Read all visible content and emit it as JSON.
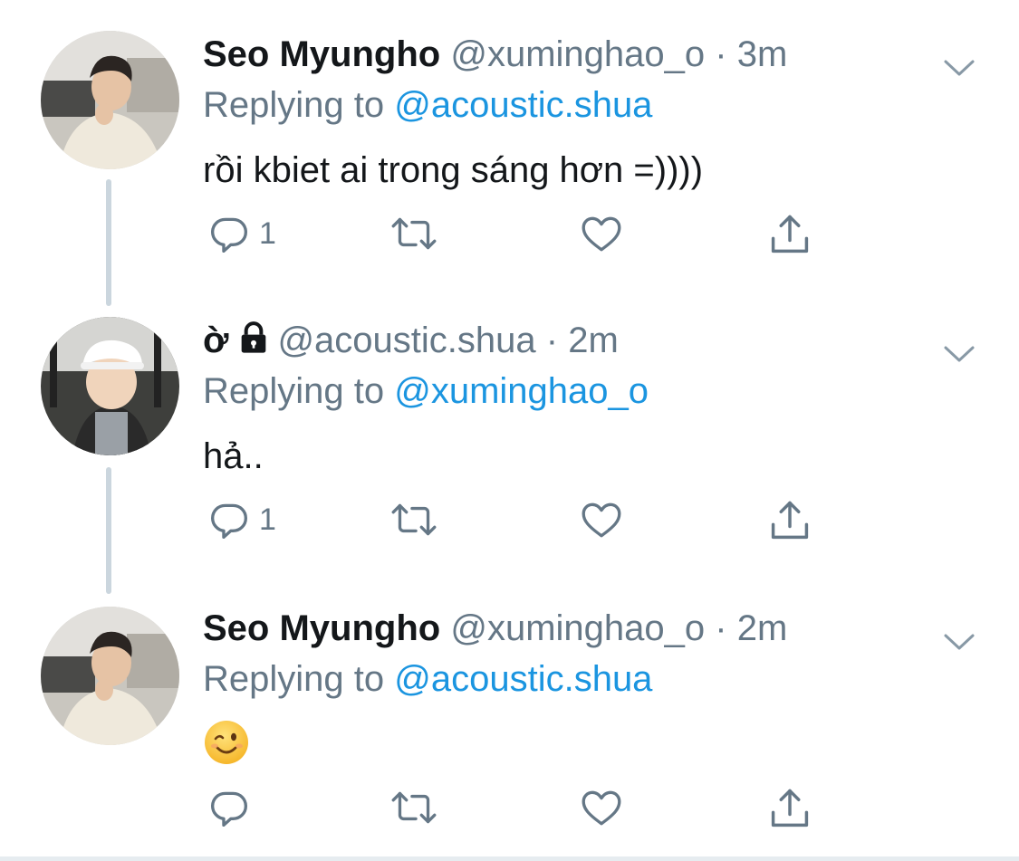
{
  "tweets": [
    {
      "name": "Seo Myungho",
      "handle": "@xuminghao_o",
      "dot": "·",
      "time": "3m",
      "replying_prefix": "Replying to ",
      "replying_to": "@acoustic.shua",
      "text": "rồi kbiet ai trong sáng hơn =))))",
      "reply_count": "1",
      "avatar": "boy-in-cream-sweater"
    },
    {
      "name": "ờ",
      "handle": "@acoustic.shua",
      "dot": "·",
      "time": "2m",
      "protected": true,
      "replying_prefix": "Replying to ",
      "replying_to": "@xuminghao_o",
      "text": "hả..",
      "reply_count": "1",
      "avatar": "child-in-white-hat"
    },
    {
      "name": "Seo Myungho",
      "handle": "@xuminghao_o",
      "dot": "·",
      "time": "2m",
      "replying_prefix": "Replying to ",
      "replying_to": "@acoustic.shua",
      "text": "😉",
      "reply_count": "",
      "avatar": "boy-in-cream-sweater"
    }
  ],
  "icons": {
    "reply": "reply-bubble-icon",
    "retweet": "retweet-icon",
    "like": "heart-icon",
    "share": "share-icon",
    "menu": "chevron-down-icon",
    "lock": "lock-icon"
  },
  "colors": {
    "text": "#14171a",
    "secondary": "#657786",
    "link": "#1b95e0",
    "thread_line": "#cbd6de"
  }
}
